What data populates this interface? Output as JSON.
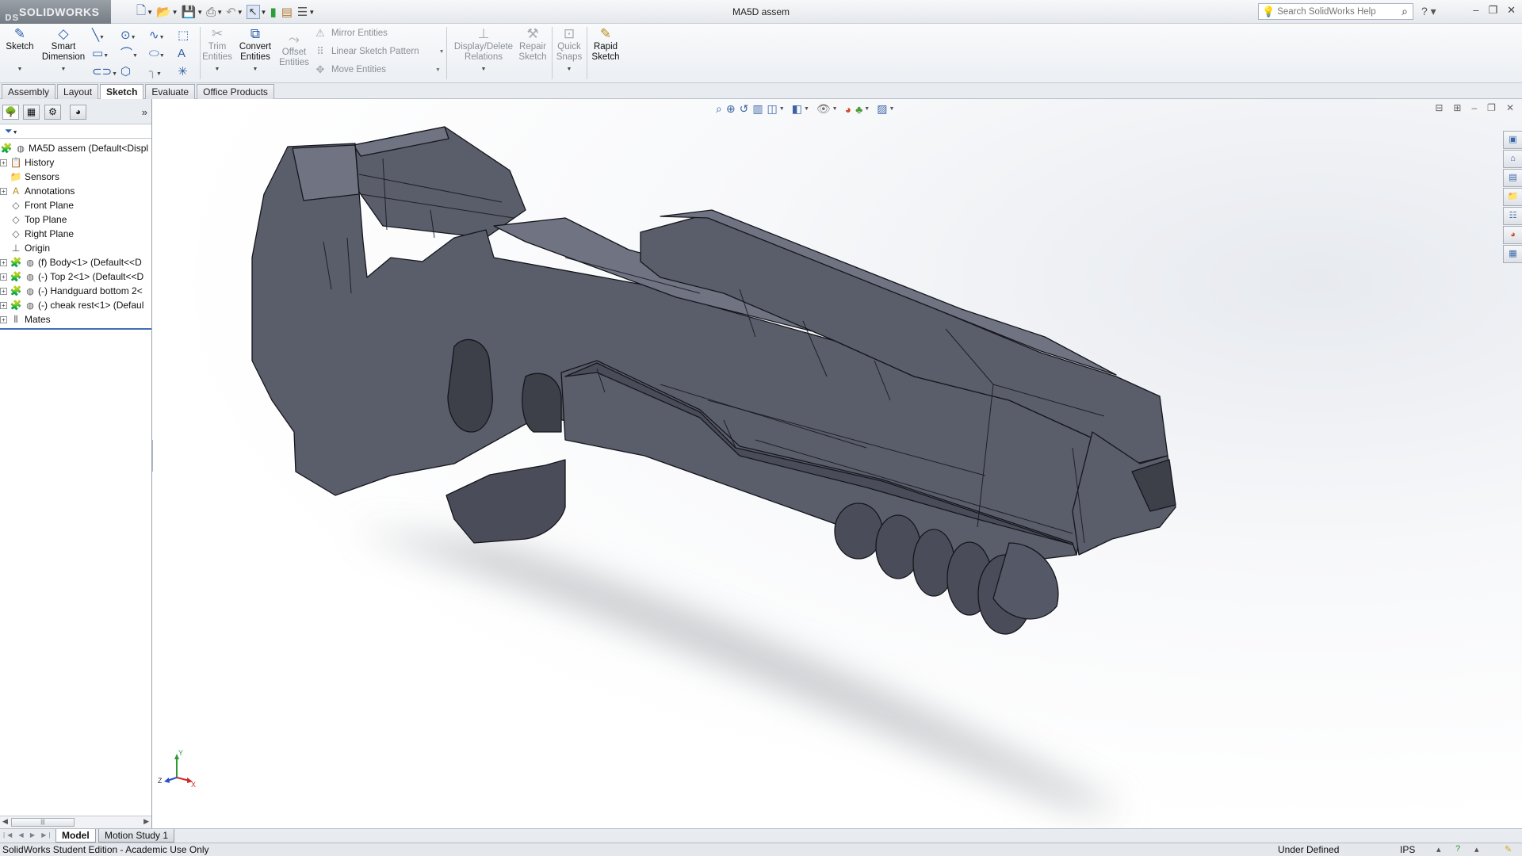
{
  "app": {
    "brand": "SOLIDWORKS",
    "document_title": "MA5D assem"
  },
  "search": {
    "placeholder": "Search SolidWorks Help"
  },
  "commands": {
    "sketch": "Sketch",
    "smart_dimension_line1": "Smart",
    "smart_dimension_line2": "Dimension",
    "trim_line1": "Trim",
    "trim_line2": "Entities",
    "convert_line1": "Convert",
    "convert_line2": "Entities",
    "offset_line1": "Offset",
    "offset_line2": "Entities",
    "mirror_entities": "Mirror Entities",
    "linear_sketch_pattern": "Linear Sketch Pattern",
    "move_entities": "Move Entities",
    "display_delete_line1": "Display/Delete",
    "display_delete_line2": "Relations",
    "repair_line1": "Repair",
    "repair_line2": "Sketch",
    "quick_snaps_line1": "Quick",
    "quick_snaps_line2": "Snaps",
    "rapid_sketch_line1": "Rapid",
    "rapid_sketch_line2": "Sketch"
  },
  "tabs": [
    "Assembly",
    "Layout",
    "Sketch",
    "Evaluate",
    "Office Products"
  ],
  "active_tab": "Sketch",
  "tree": {
    "root": "MA5D assem  (Default<Displ",
    "items": [
      {
        "label": "History",
        "expandable": true
      },
      {
        "label": "Sensors",
        "expandable": false
      },
      {
        "label": "Annotations",
        "expandable": true
      },
      {
        "label": "Front Plane",
        "expandable": false
      },
      {
        "label": "Top Plane",
        "expandable": false
      },
      {
        "label": "Right Plane",
        "expandable": false
      },
      {
        "label": "Origin",
        "expandable": false
      },
      {
        "label": "(f) Body<1> (Default<<D",
        "expandable": true
      },
      {
        "label": "(-) Top 2<1> (Default<<D",
        "expandable": true
      },
      {
        "label": "(-) Handguard bottom 2<",
        "expandable": true
      },
      {
        "label": "(-) cheak rest<1> (Defaul",
        "expandable": true
      },
      {
        "label": "Mates",
        "expandable": true
      }
    ]
  },
  "triad": {
    "x": "X",
    "y": "Y",
    "z": "Z"
  },
  "bottom_tabs": [
    "Model",
    "Motion Study 1"
  ],
  "status": {
    "edition": "SolidWorks Student Edition - Academic Use Only",
    "sketch_state": "Under Defined",
    "units": "IPS"
  },
  "colors": {
    "model_face": "#5a5d6a",
    "model_edge": "#15161c",
    "accent": "#3f6db5"
  }
}
